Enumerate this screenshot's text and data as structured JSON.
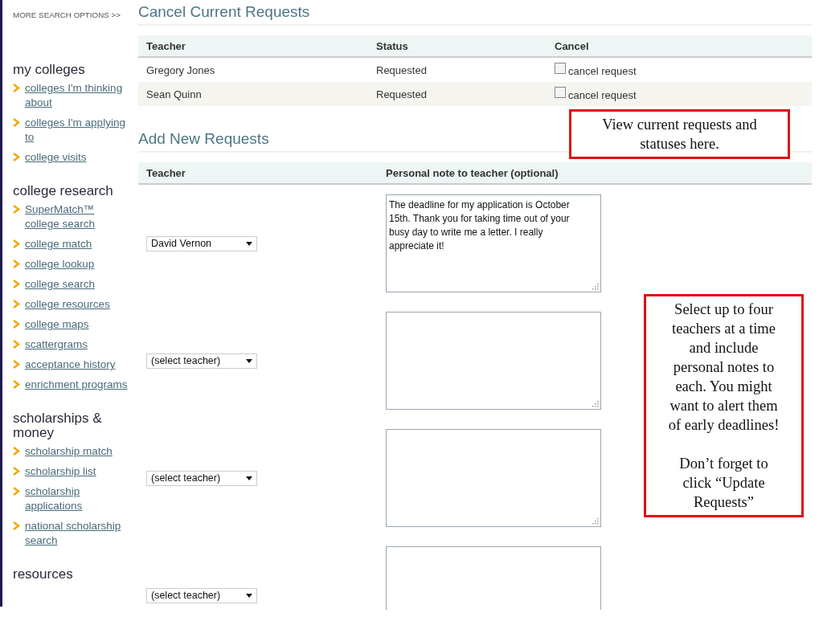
{
  "sidebar": {
    "more_search_link": "MORE SEARCH OPTIONS >>",
    "sections": [
      {
        "title": "my colleges",
        "links": [
          "colleges I'm thinking about",
          "colleges I'm applying to",
          "college visits"
        ]
      },
      {
        "title": "college research",
        "links": [
          "SuperMatch™ college search",
          "college match",
          "college lookup",
          "college search",
          "college resources",
          "college maps",
          "scattergrams",
          "acceptance history",
          "enrichment programs"
        ]
      },
      {
        "title": "scholarships & money",
        "links": [
          "scholarship match",
          "scholarship list",
          "scholarship applications",
          "national scholarship search"
        ]
      },
      {
        "title": "resources"
      }
    ]
  },
  "cancel_section": {
    "title": "Cancel Current Requests",
    "columns": [
      "Teacher",
      "Status",
      "Cancel"
    ],
    "rows": [
      {
        "teacher": "Gregory Jones",
        "status": "Requested",
        "cancel_label": "cancel request",
        "checked": false
      },
      {
        "teacher": "Sean Quinn",
        "status": "Requested",
        "cancel_label": "cancel request",
        "checked": false
      }
    ]
  },
  "add_section": {
    "title": "Add New Requests",
    "columns": [
      "Teacher",
      "Personal note to teacher (optional)"
    ],
    "rows": [
      {
        "teacher": "David Vernon",
        "note": "The deadline for my application is October 15th.  Thank you for taking time out of your busy day to write me a letter.  I really appreciate it!"
      },
      {
        "teacher": "(select teacher)",
        "note": ""
      },
      {
        "teacher": "(select teacher)",
        "note": ""
      },
      {
        "teacher": "(select teacher)",
        "note": ""
      }
    ]
  },
  "callouts": [
    {
      "paragraphs": [
        "View current requests and statuses here."
      ]
    },
    {
      "paragraphs": [
        "Select up to four teachers at a time and include personal notes to each.  You might want to alert them of early deadlines!",
        "Don’t forget to click “Update Requests”"
      ]
    }
  ]
}
